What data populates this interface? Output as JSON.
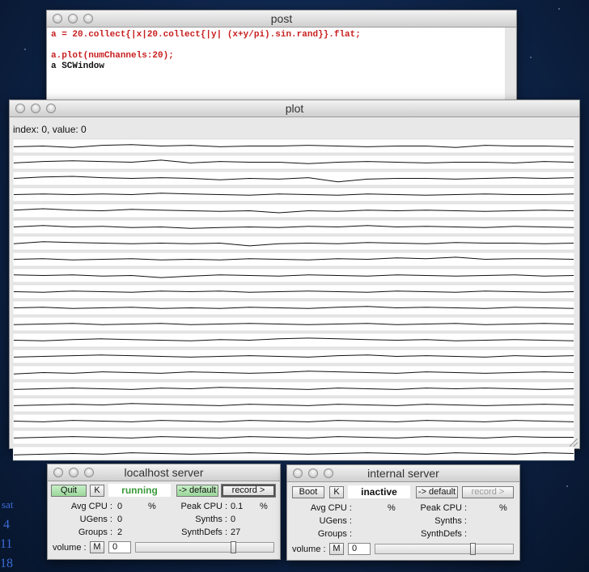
{
  "windows": {
    "post": {
      "title": "post",
      "lines": [
        {
          "text": "a = 20.collect{|x|20.collect{|y| (x+y/pi).sin.rand}}.flat;",
          "color": "#c81e1e"
        },
        {
          "text": "",
          "color": "#111111"
        },
        {
          "text": "a.plot(numChannels:20);",
          "color": "#c81e1e"
        },
        {
          "text": "a SCWindow",
          "color": "#111111"
        }
      ]
    },
    "plot": {
      "title": "plot",
      "readout": "index: 0, value: 0"
    },
    "localhost": {
      "title": "localhost server",
      "quit_label": "Quit",
      "k_label": "K",
      "status": "running",
      "status_color": "#3a9a3a",
      "default_label": "-> default",
      "record_label": "record >",
      "avg_cpu_label": "Avg CPU :",
      "avg_cpu_value": "0",
      "percent": "%",
      "peak_cpu_label": "Peak CPU :",
      "peak_cpu_value": "0.1",
      "ugens_label": "UGens :",
      "ugens_value": "0",
      "synths_label": "Synths :",
      "synths_value": "0",
      "groups_label": "Groups :",
      "groups_value": "2",
      "synthdefs_label": "SynthDefs :",
      "synthdefs_value": "27",
      "volume_label": "volume :",
      "mute_label": "M",
      "volume_value": "0",
      "volume_level": 0.72
    },
    "internal": {
      "title": "internal server",
      "boot_label": "Boot",
      "k_label": "K",
      "status": "inactive",
      "default_label": "-> default",
      "record_label": "record >",
      "avg_cpu_label": "Avg CPU :",
      "percent": "%",
      "peak_cpu_label": "Peak CPU :",
      "ugens_label": "UGens :",
      "synths_label": "Synths :",
      "groups_label": "Groups :",
      "synthdefs_label": "SynthDefs :",
      "volume_label": "volume :",
      "mute_label": "M",
      "volume_value": "0",
      "volume_level": 0.72
    }
  },
  "desktop_edge_text": [
    "sat",
    "4",
    "11",
    "18"
  ],
  "chart_data": {
    "type": "line",
    "channels": 20,
    "points_per_channel": 20,
    "ylim": [
      0,
      1
    ],
    "xlim": [
      0,
      19
    ],
    "grid": false,
    "series_color": "#111111",
    "series": [
      {
        "values": [
          0.45,
          0.5,
          0.4,
          0.55,
          0.6,
          0.5,
          0.55,
          0.45,
          0.5,
          0.5,
          0.55,
          0.5,
          0.45,
          0.5,
          0.5,
          0.4,
          0.55,
          0.5,
          0.5,
          0.45
        ]
      },
      {
        "values": [
          0.45,
          0.55,
          0.6,
          0.55,
          0.5,
          0.65,
          0.45,
          0.55,
          0.5,
          0.5,
          0.4,
          0.5,
          0.55,
          0.5,
          0.45,
          0.5,
          0.5,
          0.45,
          0.55,
          0.5
        ]
      },
      {
        "values": [
          0.5,
          0.6,
          0.65,
          0.55,
          0.5,
          0.55,
          0.5,
          0.4,
          0.5,
          0.45,
          0.55,
          0.25,
          0.45,
          0.5,
          0.5,
          0.45,
          0.5,
          0.55,
          0.5,
          0.55
        ]
      },
      {
        "values": [
          0.5,
          0.55,
          0.5,
          0.55,
          0.5,
          0.6,
          0.55,
          0.5,
          0.45,
          0.55,
          0.5,
          0.45,
          0.55,
          0.5,
          0.45,
          0.5,
          0.55,
          0.5,
          0.5,
          0.55
        ]
      },
      {
        "values": [
          0.55,
          0.65,
          0.55,
          0.5,
          0.6,
          0.55,
          0.5,
          0.45,
          0.5,
          0.35,
          0.5,
          0.45,
          0.55,
          0.5,
          0.55,
          0.5,
          0.45,
          0.5,
          0.55,
          0.5
        ]
      },
      {
        "values": [
          0.5,
          0.6,
          0.5,
          0.55,
          0.45,
          0.5,
          0.4,
          0.45,
          0.5,
          0.45,
          0.55,
          0.5,
          0.6,
          0.5,
          0.55,
          0.5,
          0.45,
          0.55,
          0.5,
          0.45
        ]
      },
      {
        "values": [
          0.45,
          0.6,
          0.55,
          0.5,
          0.45,
          0.5,
          0.45,
          0.5,
          0.3,
          0.45,
          0.5,
          0.45,
          0.55,
          0.5,
          0.45,
          0.55,
          0.5,
          0.5,
          0.45,
          0.5
        ]
      },
      {
        "values": [
          0.5,
          0.55,
          0.45,
          0.5,
          0.55,
          0.45,
          0.5,
          0.45,
          0.55,
          0.5,
          0.45,
          0.55,
          0.5,
          0.6,
          0.55,
          0.65,
          0.5,
          0.55,
          0.55,
          0.5
        ]
      },
      {
        "values": [
          0.55,
          0.5,
          0.55,
          0.45,
          0.5,
          0.35,
          0.45,
          0.55,
          0.5,
          0.45,
          0.55,
          0.5,
          0.45,
          0.55,
          0.5,
          0.45,
          0.5,
          0.55,
          0.45,
          0.5
        ]
      },
      {
        "values": [
          0.5,
          0.45,
          0.55,
          0.5,
          0.45,
          0.55,
          0.5,
          0.55,
          0.45,
          0.5,
          0.55,
          0.5,
          0.45,
          0.55,
          0.5,
          0.45,
          0.55,
          0.5,
          0.45,
          0.5
        ]
      },
      {
        "values": [
          0.5,
          0.55,
          0.45,
          0.5,
          0.55,
          0.45,
          0.5,
          0.45,
          0.55,
          0.5,
          0.45,
          0.55,
          0.6,
          0.5,
          0.55,
          0.5,
          0.45,
          0.55,
          0.5,
          0.45
        ]
      },
      {
        "values": [
          0.45,
          0.5,
          0.55,
          0.45,
          0.5,
          0.55,
          0.45,
          0.5,
          0.55,
          0.5,
          0.45,
          0.5,
          0.55,
          0.45,
          0.5,
          0.55,
          0.45,
          0.5,
          0.55,
          0.5
        ]
      },
      {
        "values": [
          0.5,
          0.45,
          0.55,
          0.6,
          0.55,
          0.5,
          0.45,
          0.55,
          0.5,
          0.6,
          0.65,
          0.6,
          0.55,
          0.5,
          0.55,
          0.45,
          0.5,
          0.55,
          0.5,
          0.45
        ]
      },
      {
        "values": [
          0.45,
          0.5,
          0.55,
          0.6,
          0.55,
          0.5,
          0.45,
          0.5,
          0.55,
          0.5,
          0.45,
          0.55,
          0.6,
          0.5,
          0.55,
          0.5,
          0.45,
          0.55,
          0.5,
          0.55
        ]
      },
      {
        "values": [
          0.4,
          0.5,
          0.45,
          0.55,
          0.5,
          0.45,
          0.55,
          0.5,
          0.45,
          0.5,
          0.6,
          0.55,
          0.5,
          0.45,
          0.55,
          0.5,
          0.45,
          0.5,
          0.55,
          0.5
        ]
      },
      {
        "values": [
          0.45,
          0.5,
          0.55,
          0.5,
          0.45,
          0.55,
          0.5,
          0.6,
          0.55,
          0.5,
          0.45,
          0.55,
          0.5,
          0.45,
          0.55,
          0.5,
          0.55,
          0.5,
          0.45,
          0.5
        ]
      },
      {
        "values": [
          0.45,
          0.5,
          0.55,
          0.5,
          0.6,
          0.55,
          0.5,
          0.45,
          0.55,
          0.5,
          0.45,
          0.55,
          0.5,
          0.45,
          0.55,
          0.5,
          0.45,
          0.5,
          0.55,
          0.5
        ]
      },
      {
        "values": [
          0.5,
          0.45,
          0.55,
          0.5,
          0.45,
          0.55,
          0.5,
          0.45,
          0.55,
          0.5,
          0.45,
          0.55,
          0.5,
          0.45,
          0.55,
          0.5,
          0.45,
          0.55,
          0.5,
          0.45
        ]
      },
      {
        "values": [
          0.45,
          0.5,
          0.55,
          0.5,
          0.45,
          0.55,
          0.5,
          0.45,
          0.55,
          0.5,
          0.45,
          0.55,
          0.5,
          0.45,
          0.55,
          0.5,
          0.45,
          0.55,
          0.5,
          0.5
        ]
      },
      {
        "values": [
          0.4,
          0.45,
          0.5,
          0.45,
          0.55,
          0.5,
          0.45,
          0.5,
          0.55,
          0.5,
          0.45,
          0.5,
          0.55,
          0.5,
          0.45,
          0.55,
          0.5,
          0.45,
          0.55,
          0.5
        ]
      }
    ]
  }
}
